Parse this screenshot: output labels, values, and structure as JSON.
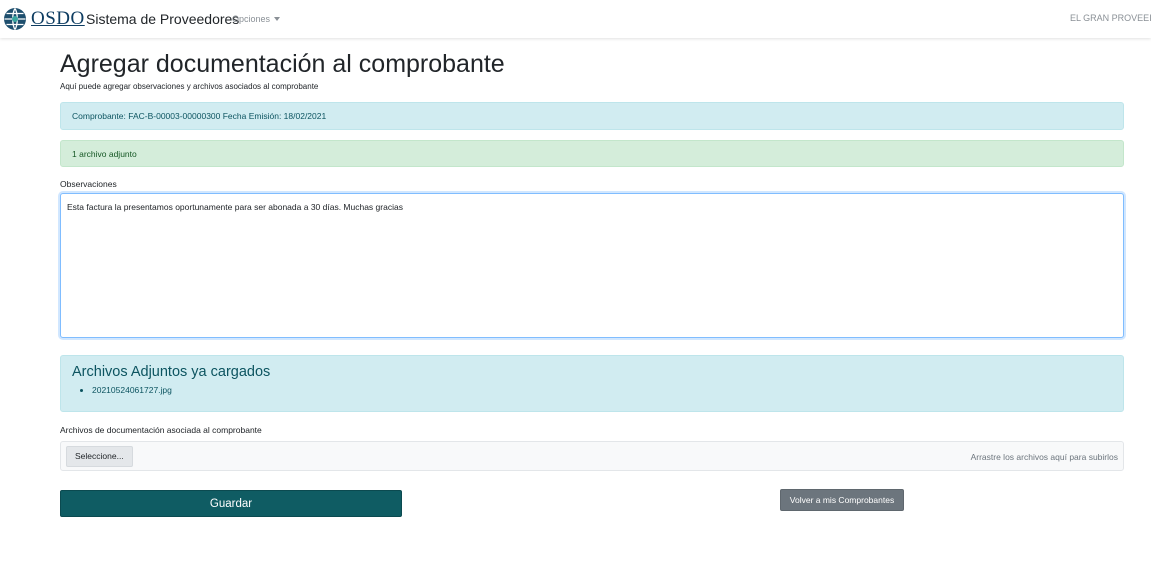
{
  "navbar": {
    "logo_text": "OSDO",
    "logo_icon": "globe-emblem-icon",
    "title": "Sistema de Proveedores",
    "options_label": "Opciones",
    "user_name": "EL GRAN PROVEEI"
  },
  "page": {
    "title": "Agregar documentación al comprobante",
    "subtitle": "Aquí puede agregar observaciones y archivos asociados al comprobante"
  },
  "comprobante_info": "Comprobante: FAC-B-00003-00000300 Fecha Emisión: 18/02/2021",
  "attachment_count": "1 archivo adjunto",
  "observaciones": {
    "label": "Observaciones",
    "value": "Esta factura la presentamos oportunamente para ser abonada a 30 días. Muchas gracias"
  },
  "attached_files": {
    "title": "Archivos Adjuntos ya cargados",
    "files": [
      "20210524061727.jpg"
    ]
  },
  "upload": {
    "label": "Archivos de documentación asociada al comprobante",
    "select_label": "Seleccione...",
    "drop_hint": "Arrastre los archivos aquí para subirlos"
  },
  "actions": {
    "save_label": "Guardar",
    "back_label": "Volver a mis Comprobantes"
  },
  "colors": {
    "primary": "#0f5c63",
    "info_bg": "#d1ecf1",
    "success_bg": "#d4edda",
    "secondary": "#6c757d"
  }
}
